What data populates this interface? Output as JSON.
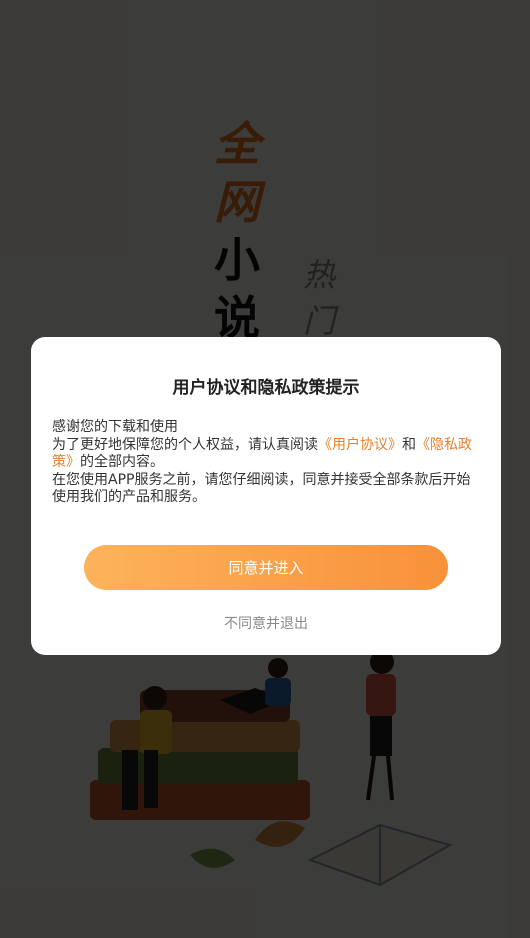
{
  "splash": {
    "title_chars": [
      "全",
      "网",
      "小",
      "说"
    ],
    "side_chars": [
      "热",
      "门"
    ]
  },
  "dialog": {
    "title": "用户协议和隐私政策提示",
    "line1": "感谢您的下载和使用",
    "line2_prefix": "为了更好地保障您的个人权益，请认真阅读",
    "user_agreement_link": "《用户协议》",
    "and_text": "和",
    "privacy_policy_link": "《隐私政策》",
    "line2_suffix": "的全部内容。",
    "line3": "在您使用APP服务之前，请您仔细阅读，同意并接受全部条款后开始使用我们的产品和服务。",
    "agree_label": "同意并进入",
    "disagree_label": "不同意并退出"
  },
  "colors": {
    "accent": "#f8913a",
    "link": "#e8812e",
    "title_orange": "#e8751f"
  }
}
